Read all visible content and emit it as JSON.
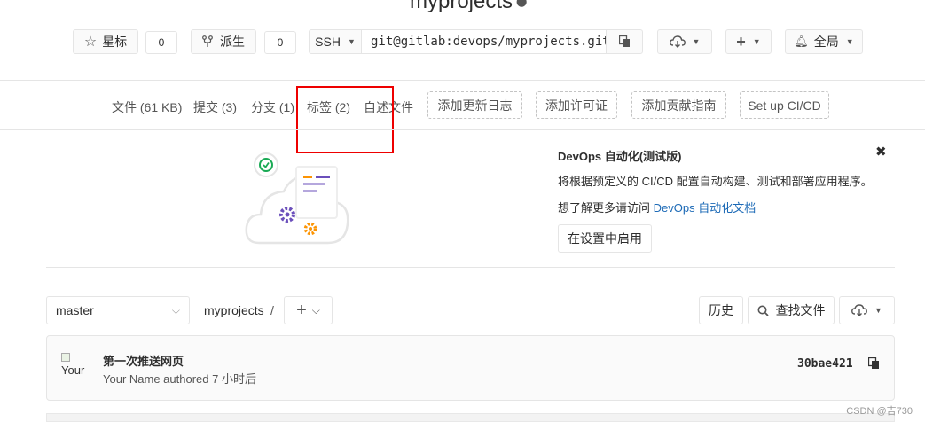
{
  "project": {
    "title": "myprojects"
  },
  "header": {
    "star_label": "星标",
    "star_count": "0",
    "fork_label": "派生",
    "fork_count": "0",
    "protocol": "SSH",
    "clone_url": "git@gitlab:devops/myprojects.git",
    "global_label": "全局"
  },
  "stats_nav": {
    "files": "文件 (61 KB)",
    "commits": "提交 (3)",
    "branches": "分支 (1)",
    "tags": "标签 (2)",
    "readme": "自述文件",
    "add_changelog": "添加更新日志",
    "add_license": "添加许可证",
    "add_contributing": "添加贡献指南",
    "setup_ci": "Set up CI/CD"
  },
  "autodevops": {
    "title": "DevOps 自动化(测试版)",
    "description": "将根据预定义的 CI/CD 配置自动构建、测试和部署应用程序。",
    "learn_more_prefix": "想了解更多请访问 ",
    "learn_more_link": "DevOps 自动化文档",
    "enable_button": "在设置中启用"
  },
  "tree": {
    "branch": "master",
    "path": "myprojects",
    "separator": "/",
    "history_button": "历史",
    "find_file_button": "查找文件"
  },
  "last_commit": {
    "avatar_alt": "Your",
    "title": "第一次推送网页",
    "author_line": "Your Name authored 7 小时后",
    "sha": "30bae421"
  },
  "watermark": "CSDN @吉730",
  "colors": {
    "link": "#1b69b6",
    "annotation_red": "#ee0000",
    "illustration_green": "#1aaa55",
    "illustration_purple": "#6b4fbb",
    "illustration_orange": "#fc9403"
  }
}
